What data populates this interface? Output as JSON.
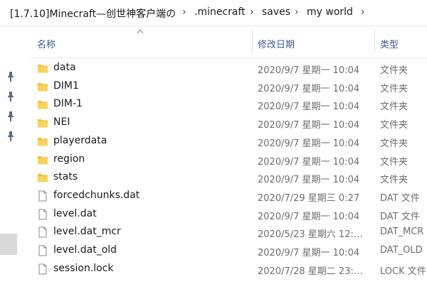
{
  "breadcrumb": {
    "root": "[1.7.10]Minecraft—创世神客户端の",
    "items": [
      ".minecraft",
      "saves",
      "my world"
    ]
  },
  "columns": {
    "name": "名称",
    "modified": "修改日期",
    "type": "类型"
  },
  "files": [
    {
      "name": "data",
      "modified": "2020/9/7 星期一 10:04",
      "type": "文件夹",
      "icon": "folder-icon"
    },
    {
      "name": "DIM1",
      "modified": "2020/9/7 星期一 10:04",
      "type": "文件夹",
      "icon": "folder-icon"
    },
    {
      "name": "DIM-1",
      "modified": "2020/9/7 星期一 10:04",
      "type": "文件夹",
      "icon": "folder-icon"
    },
    {
      "name": "NEI",
      "modified": "2020/9/7 星期一 10:04",
      "type": "文件夹",
      "icon": "folder-icon"
    },
    {
      "name": "playerdata",
      "modified": "2020/9/7 星期一 10:04",
      "type": "文件夹",
      "icon": "folder-icon"
    },
    {
      "name": "region",
      "modified": "2020/9/7 星期一 10:04",
      "type": "文件夹",
      "icon": "folder-icon"
    },
    {
      "name": "stats",
      "modified": "2020/9/7 星期一 10:04",
      "type": "文件夹",
      "icon": "folder-icon"
    },
    {
      "name": "forcedchunks.dat",
      "modified": "2020/7/29 星期三 0:27",
      "type": "DAT 文件",
      "icon": "file-icon"
    },
    {
      "name": "level.dat",
      "modified": "2020/9/7 星期一 10:04",
      "type": "DAT 文件",
      "icon": "file-icon"
    },
    {
      "name": "level.dat_mcr",
      "modified": "2020/5/23 星期六 12:…",
      "type": "DAT_MCR",
      "icon": "file-icon"
    },
    {
      "name": "level.dat_old",
      "modified": "2020/9/7 星期一 10:04",
      "type": "DAT_OLD",
      "icon": "file-icon"
    },
    {
      "name": "session.lock",
      "modified": "2020/7/28 星期二 23:…",
      "type": "LOCK 文件",
      "icon": "file-icon"
    }
  ],
  "colors": {
    "folder": "#f3c230",
    "header_text": "#3b5b8c",
    "meta_text": "#6d6d6d"
  }
}
